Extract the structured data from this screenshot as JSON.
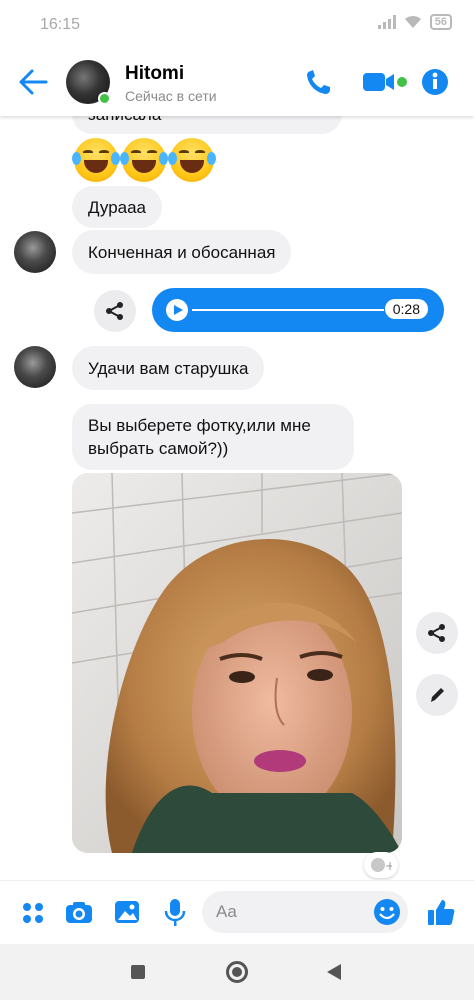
{
  "status_bar": {
    "time": "16:15",
    "battery": "56"
  },
  "header": {
    "contact_name": "Hitomi",
    "status": "Сейчас в сети"
  },
  "messages": [
    {
      "text": "записала"
    },
    {
      "text": "Дурааа"
    },
    {
      "text": "Конченная и обосанная"
    },
    {
      "text": "Удачи вам старушка"
    },
    {
      "text": "Вы выберете фотку,или мне выбрать самой?))"
    }
  ],
  "audio": {
    "duration": "0:28"
  },
  "composer": {
    "placeholder": "Aa"
  },
  "colors": {
    "accent": "#1488f2",
    "bubble": "#f1f1f3",
    "online": "#43c046"
  },
  "icons": [
    "back-arrow-icon",
    "phone-icon",
    "video-icon",
    "info-icon",
    "share-icon",
    "edit-icon",
    "apps-icon",
    "camera-icon",
    "gallery-icon",
    "mic-icon",
    "emoji-icon",
    "like-icon"
  ]
}
